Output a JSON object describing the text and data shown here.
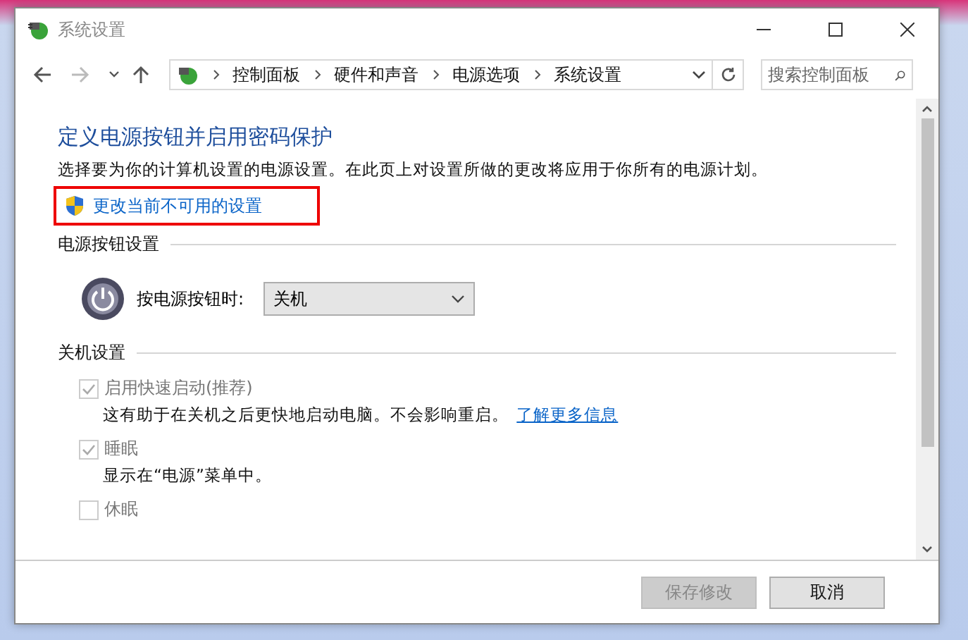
{
  "window": {
    "title": "系统设置"
  },
  "address_bar": {
    "breadcrumbs": [
      "控制面板",
      "硬件和声音",
      "电源选项",
      "系统设置"
    ]
  },
  "search": {
    "placeholder": "搜索控制面板"
  },
  "heading": "定义电源按钮并启用密码保护",
  "description": "选择要为你的计算机设置的电源设置。在此页上对设置所做的更改将应用于你所有的电源计划。",
  "admin_link": "更改当前不可用的设置",
  "power_button_section": {
    "title": "电源按钮设置",
    "label": "按电源按钮时:",
    "value": "关机"
  },
  "shutdown_section": {
    "title": "关机设置",
    "options": [
      {
        "label": "启用快速启动(推荐)",
        "checked": true,
        "disabled": true,
        "description": "这有助于在关机之后更快地启动电脑。不会影响重启。",
        "link": "了解更多信息"
      },
      {
        "label": "睡眠",
        "checked": true,
        "disabled": true,
        "description": "显示在“电源”菜单中。"
      },
      {
        "label": "休眠",
        "checked": false,
        "disabled": true
      }
    ]
  },
  "buttons": [
    {
      "label": "保存修改",
      "disabled": true
    },
    {
      "label": "取消",
      "disabled": false
    }
  ]
}
